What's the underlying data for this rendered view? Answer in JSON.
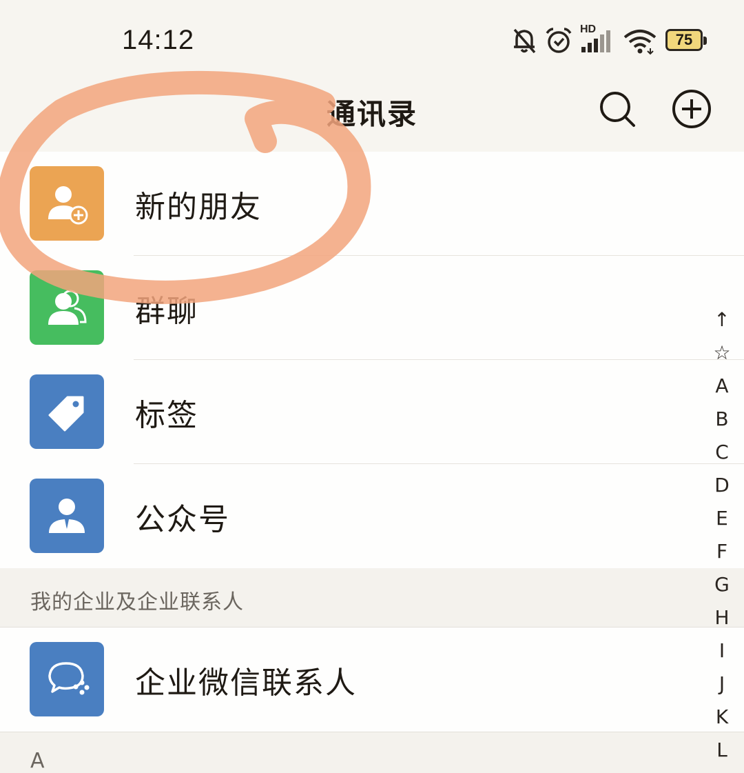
{
  "status_bar": {
    "time": "14:12",
    "battery": "75",
    "network_badge": "HD",
    "icons": [
      "mute-icon",
      "alarm-icon",
      "signal-icon",
      "wifi-icon",
      "battery-icon"
    ]
  },
  "header": {
    "title": "通讯录",
    "search_icon": "search-icon",
    "add_icon": "add-circle-icon"
  },
  "menu": [
    {
      "label": "新的朋友",
      "icon": "new-friend-icon",
      "color": "#eba453"
    },
    {
      "label": "群聊",
      "icon": "group-chat-icon",
      "color": "#46bd5f"
    },
    {
      "label": "标签",
      "icon": "tag-icon",
      "color": "#4a7fc1"
    },
    {
      "label": "公众号",
      "icon": "official-account-icon",
      "color": "#4a7fc1"
    }
  ],
  "enterprise_section": {
    "header": "我的企业及企业联系人",
    "item": {
      "label": "企业微信联系人",
      "icon": "wecom-contacts-icon",
      "color": "#4a7fc1"
    }
  },
  "contacts_section": {
    "letter": "A"
  },
  "index_bar": [
    "↑",
    "☆",
    "A",
    "B",
    "C",
    "D",
    "E",
    "F",
    "G",
    "H",
    "I",
    "J",
    "K",
    "L"
  ],
  "annotation": {
    "color": "#f2a47c",
    "type": "hand-drawn circle around 新的朋友"
  }
}
